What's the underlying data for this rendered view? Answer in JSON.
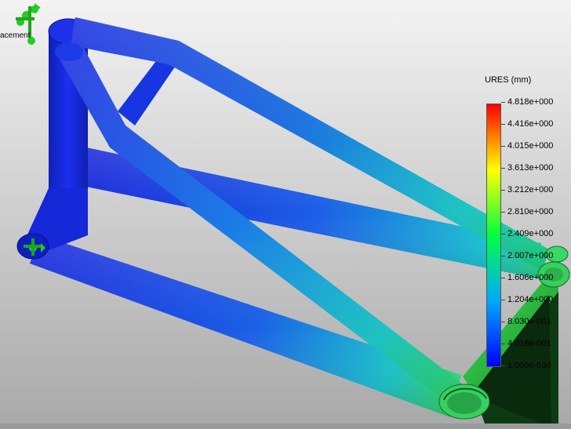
{
  "viewport": {
    "background_top": "#f4f4f4",
    "background_bottom": "#a9a9a9"
  },
  "fixture_label": "acement",
  "legend": {
    "title": "URES (mm)",
    "colors": [
      "#0000ff",
      "#00bfff",
      "#00ff00",
      "#ffff00",
      "#ff0000"
    ],
    "ticks": [
      "4.818e+000",
      "4.416e+000",
      "4.015e+000",
      "3.613e+000",
      "3.212e+000",
      "2.810e+000",
      "2.409e+000",
      "2.007e+000",
      "1.606e+000",
      "1.204e+000",
      "8.030e-001",
      "4.016e-001",
      "1.000e-030"
    ]
  },
  "icons": {
    "fixture_top": "fixed-geometry-icon",
    "fixture_left": "fixed-geometry-icon"
  }
}
